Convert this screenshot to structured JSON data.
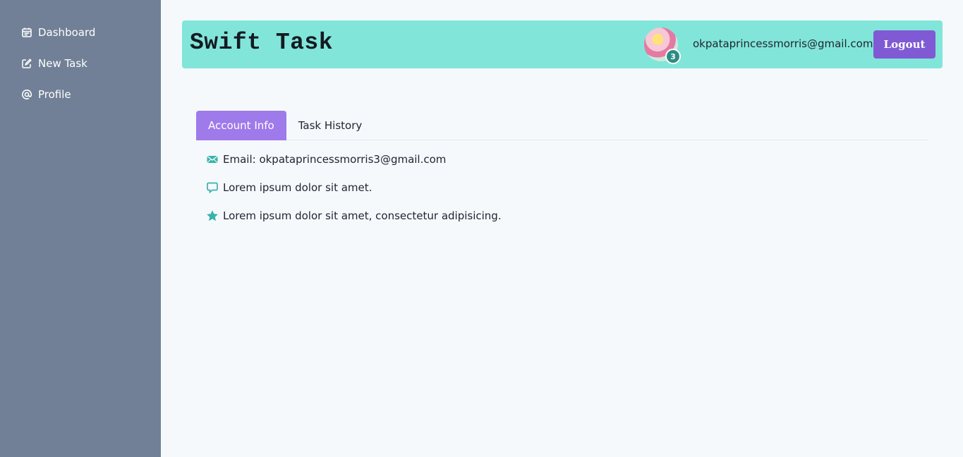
{
  "sidebar": {
    "items": [
      {
        "label": "Dashboard",
        "icon": "calendar-icon"
      },
      {
        "label": "New Task",
        "icon": "edit-icon"
      },
      {
        "label": "Profile",
        "icon": "at-icon"
      }
    ]
  },
  "header": {
    "brand": "Swift Task",
    "notification_count": "3",
    "user_email": "okpataprincessmorris@gmail.com",
    "logout_label": "Logout"
  },
  "tabs": [
    {
      "label": "Account Info",
      "active": true
    },
    {
      "label": "Task History",
      "active": false
    }
  ],
  "account_info": {
    "rows": [
      {
        "icon": "envelope-icon",
        "text": "Email: okpataprincessmorris3@gmail.com"
      },
      {
        "icon": "chat-bubble-icon",
        "text": "Lorem ipsum dolor sit amet."
      },
      {
        "icon": "star-icon",
        "text": "Lorem ipsum dolor sit amet, consectetur adipisicing."
      }
    ]
  },
  "colors": {
    "sidebar_bg": "#718096",
    "header_bg": "#81e6d9",
    "logout_bg": "#805ad5",
    "active_tab_bg": "#9f7aea",
    "icon_teal": "#38b2ac"
  }
}
